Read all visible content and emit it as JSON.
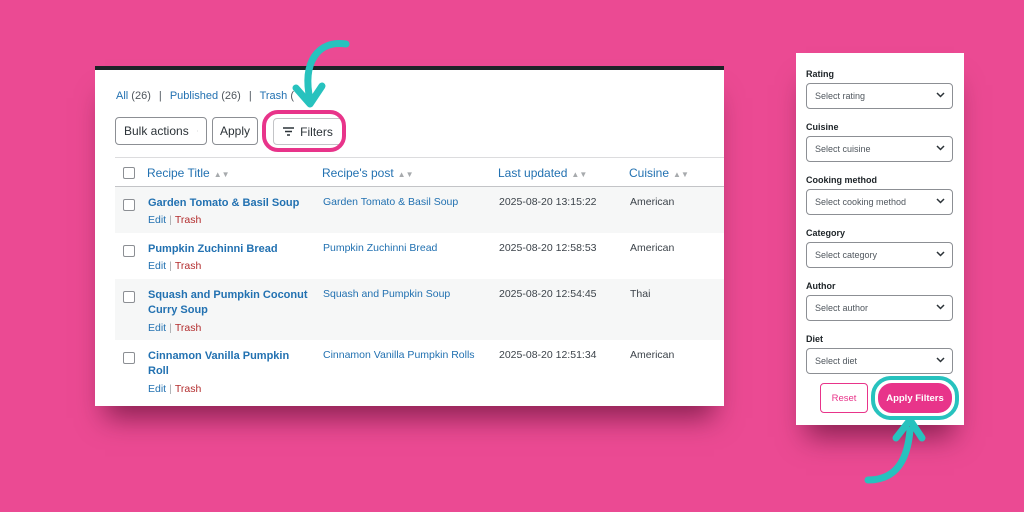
{
  "views": {
    "all": {
      "label": "All",
      "count": "(26)"
    },
    "published": {
      "label": "Published",
      "count": "(26)"
    },
    "trash": {
      "label": "Trash",
      "count": "("
    }
  },
  "toolbar": {
    "bulk_actions": "Bulk actions",
    "apply": "Apply",
    "filters": "Filters"
  },
  "columns": {
    "title": "Recipe Title",
    "post": "Recipe's post",
    "updated": "Last updated",
    "cuisine": "Cuisine"
  },
  "row_actions": {
    "edit": "Edit",
    "trash": "Trash"
  },
  "rows": [
    {
      "title": "Garden Tomato & Basil Soup",
      "post": "Garden Tomato & Basil Soup",
      "updated": "2025-08-20 13:15:22",
      "cuisine": "American"
    },
    {
      "title": "Pumpkin Zuchinni Bread",
      "post": "Pumpkin Zuchinni Bread",
      "updated": "2025-08-20 12:58:53",
      "cuisine": "American"
    },
    {
      "title": "Squash and Pumpkin Coconut Curry Soup",
      "post": "Squash and Pumpkin Soup",
      "updated": "2025-08-20 12:54:45",
      "cuisine": "Thai"
    },
    {
      "title": "Cinnamon Vanilla Pumpkin Roll",
      "post": "Cinnamon Vanilla Pumpkin Rolls",
      "updated": "2025-08-20 12:51:34",
      "cuisine": "American"
    }
  ],
  "filters": {
    "rating": {
      "label": "Rating",
      "placeholder": "Select rating"
    },
    "cuisine": {
      "label": "Cuisine",
      "placeholder": "Select cuisine"
    },
    "cooking_method": {
      "label": "Cooking method",
      "placeholder": "Select cooking method"
    },
    "category": {
      "label": "Category",
      "placeholder": "Select category"
    },
    "author": {
      "label": "Author",
      "placeholder": "Select author"
    },
    "diet": {
      "label": "Diet",
      "placeholder": "Select diet"
    },
    "reset": "Reset",
    "apply": "Apply Filters"
  },
  "colors": {
    "background": "#EB4A93",
    "highlight_pink": "#E8348A",
    "highlight_teal": "#27C2BE",
    "link": "#2271b1",
    "trash": "#b32d2e"
  }
}
